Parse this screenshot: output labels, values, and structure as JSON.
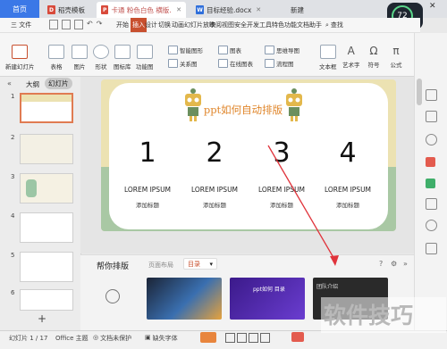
{
  "titlebar": {
    "home": "首页",
    "tabs": [
      {
        "label": "稻壳模板",
        "icon": "daoke-icon"
      },
      {
        "label": "卡通 粉色白色 横版.pptx",
        "icon": "ppt-icon"
      },
      {
        "label": "目标经验.docx",
        "icon": "word-icon"
      }
    ],
    "new_tab": "新建",
    "badge": "72"
  },
  "menu": {
    "file": "三 文件",
    "items": [
      "开始",
      "插入",
      "设计",
      "切换",
      "动画",
      "幻灯片放映",
      "审阅",
      "视图",
      "安全",
      "开发工具",
      "特色功能",
      "文档助手"
    ],
    "active": "插入",
    "search": "查找"
  },
  "ribbon": {
    "new_slide": "新建幻灯片",
    "table": "表格",
    "picture": "图片",
    "shape": "形状",
    "icon_lib": "图标库",
    "func_chart": "功能图",
    "smart_graphic": "智能图形",
    "chart": "图表",
    "relation": "关系图",
    "online_chart": "在线图表",
    "mind_map": "思维导图",
    "flowchart": "流程图",
    "textbox": "文本框",
    "art_text": "艺术字",
    "symbol": "符号",
    "formula": "公式",
    "header_footer": "页眉和页脚"
  },
  "leftpanel": {
    "outline": "大纲",
    "slides": "幻灯片",
    "numbers": [
      "1",
      "2",
      "3",
      "4",
      "5",
      "6"
    ],
    "add": "+"
  },
  "slide": {
    "title": "ppt如何自动排版",
    "columns": [
      {
        "num": "1",
        "title": "LOREM IPSUM",
        "sub": "添加标题"
      },
      {
        "num": "2",
        "title": "LOREM IPSUM",
        "sub": "添加标题"
      },
      {
        "num": "3",
        "title": "LOREM IPSUM",
        "sub": "添加标题"
      },
      {
        "num": "4",
        "title": "LOREM IPSUM",
        "sub": "添加标题"
      }
    ]
  },
  "helper": {
    "title": "帮你排版",
    "filter_label": "页面布局",
    "filter_value": "目录",
    "layouts": [
      {
        "tag": "layout-cosmic",
        "text": ""
      },
      {
        "tag": "layout-purple",
        "text": "ppt如何 目录"
      },
      {
        "tag": "layout-dark",
        "text": "团队介绍"
      }
    ]
  },
  "status": {
    "page": "幻灯片 1 / 17",
    "theme": "Office 主题",
    "protect": "文档未保护",
    "font_missing": "缺失字体"
  },
  "watermark": "软件技巧",
  "colors": {
    "accent": "#c8502f",
    "home_blue": "#3b78e7",
    "slide_yellow": "#ece2b2",
    "slide_green": "#a9c8a4",
    "arrow": "#e0333b"
  }
}
